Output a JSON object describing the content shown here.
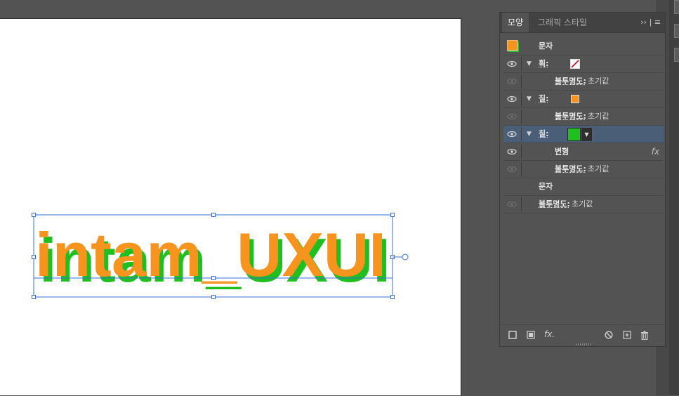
{
  "panel": {
    "tabs": [
      {
        "label": "모양"
      },
      {
        "label": "그래픽 스타일"
      }
    ],
    "menu_label": "›› | ≡",
    "rows": [
      {
        "label": "문자"
      },
      {
        "label": "획:"
      },
      {
        "label": "불투명도:",
        "value": "초기값"
      },
      {
        "label": "칠:"
      },
      {
        "label": "불투명도:",
        "value": "초기값"
      },
      {
        "label": "칠:"
      },
      {
        "label": "변형",
        "fx": "fx"
      },
      {
        "label": "불투명도:",
        "value": "초기값"
      },
      {
        "label": "문자"
      },
      {
        "label": "불투명도:",
        "value": "초기값"
      }
    ],
    "bottom": {
      "fx": "fx."
    }
  },
  "artboard": {
    "text": "intam_UXUI"
  },
  "colors": {
    "orange": "#f7941d",
    "green": "#1fbf1f",
    "selection": "#4b5e78",
    "bbox": "#3a6fd8"
  }
}
